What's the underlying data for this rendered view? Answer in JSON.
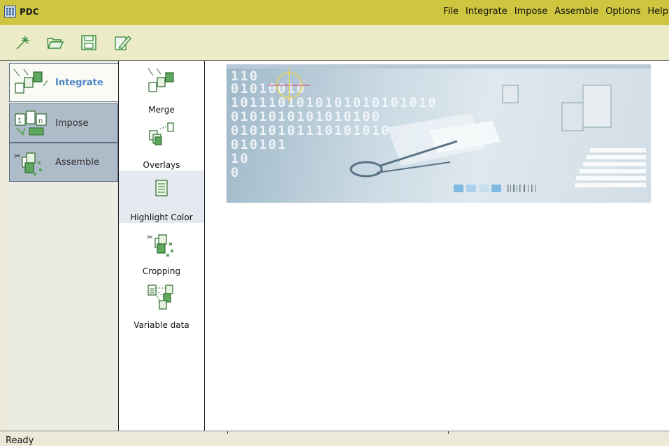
{
  "window": {
    "title": "PDC"
  },
  "menu": [
    "File",
    "Integrate",
    "Impose",
    "Assemble",
    "Options",
    "Help"
  ],
  "toolbar": {
    "buttons": [
      {
        "name": "new-icon"
      },
      {
        "name": "open-folder-icon"
      },
      {
        "name": "save-icon"
      },
      {
        "name": "edit-icon"
      }
    ]
  },
  "leftnav": {
    "items": [
      {
        "label": "Integrate",
        "active": true
      },
      {
        "label": "Impose",
        "active": false
      },
      {
        "label": "Assemble",
        "active": false
      }
    ]
  },
  "subnav": {
    "items": [
      {
        "label": "Merge"
      },
      {
        "label": "Overlays"
      },
      {
        "label": "Highlight Color"
      },
      {
        "label": "Cropping"
      },
      {
        "label": "Variable data"
      }
    ]
  },
  "banner": {
    "binary_lines": [
      "110",
      "01010010",
      "1011101010101010101010",
      "0101010101010100",
      "01010101110101010",
      "010101",
      "10",
      "0"
    ]
  },
  "status": {
    "text": "Ready"
  },
  "colors": {
    "titlebar": "#cfc63f",
    "toolbar": "#ecebc8",
    "active_nav_text": "#4f86c6",
    "inactive_nav_bg": "#aebbc8"
  }
}
